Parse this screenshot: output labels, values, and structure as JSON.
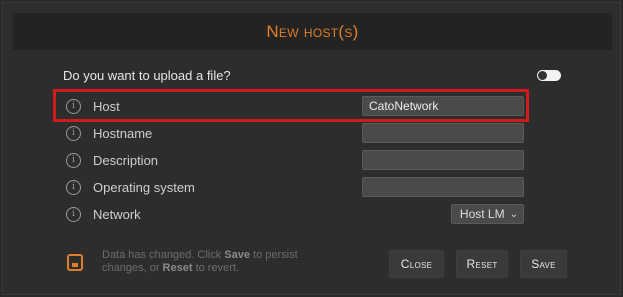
{
  "dialog": {
    "title": "New host(s)",
    "upload_prompt": "Do you want to upload a file?",
    "upload_toggle_on": false
  },
  "fields": [
    {
      "label": "Host",
      "value": "CatoNetwork"
    },
    {
      "label": "Hostname",
      "value": ""
    },
    {
      "label": "Description",
      "value": ""
    },
    {
      "label": "Operating system",
      "value": ""
    },
    {
      "label": "Network",
      "selected": "Host LM"
    }
  ],
  "footer": {
    "line1_before": "Data has changed. Click ",
    "save_word": "Save",
    "line1_after": " to persist",
    "line2_before": "changes, or ",
    "reset_word": "Reset",
    "line2_after": " to revert."
  },
  "buttons": {
    "close": "Close",
    "reset": "Reset",
    "save": "Save"
  },
  "colors": {
    "accent": "#e07e2a",
    "highlight": "#d41a1a",
    "background": "#2d2d2d"
  },
  "icons": {
    "info": "info-icon",
    "save": "floppy-disk-icon"
  }
}
